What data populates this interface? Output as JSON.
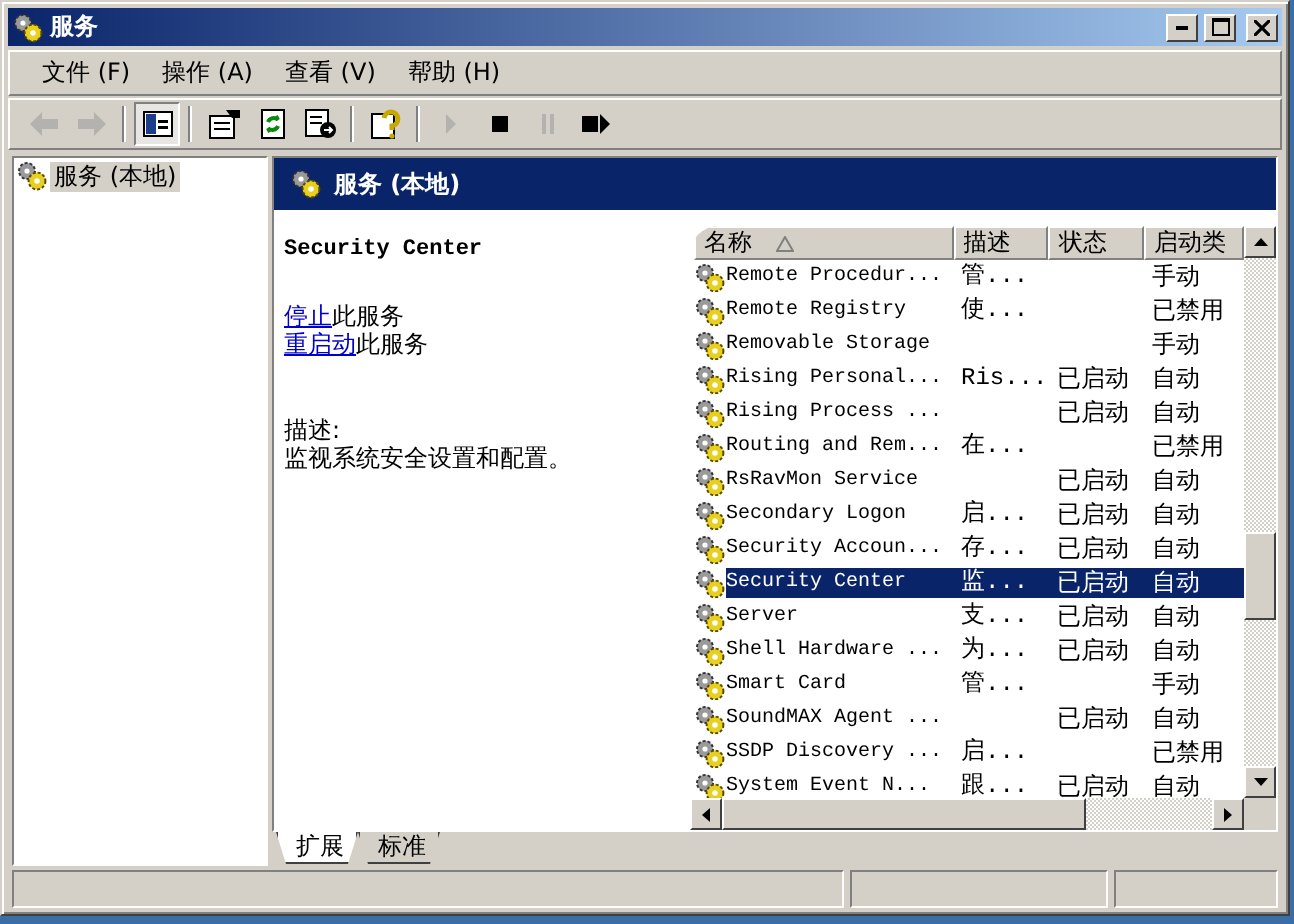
{
  "window": {
    "title": "服务"
  },
  "menu": [
    {
      "label": "文件 (F)"
    },
    {
      "label": "操作 (A)"
    },
    {
      "label": "查看 (V)"
    },
    {
      "label": "帮助 (H)"
    }
  ],
  "toolbar": [
    {
      "buttons": [
        {
          "kind": "back",
          "disabled": true,
          "pressed": false
        },
        {
          "kind": "forward",
          "disabled": true,
          "pressed": false
        }
      ]
    },
    {
      "buttons": [
        {
          "kind": "tree",
          "disabled": false,
          "pressed": true
        }
      ]
    },
    {
      "buttons": [
        {
          "kind": "properties",
          "disabled": false,
          "pressed": false
        },
        {
          "kind": "refresh",
          "disabled": false,
          "pressed": false
        },
        {
          "kind": "export",
          "disabled": false,
          "pressed": false
        }
      ]
    },
    {
      "buttons": [
        {
          "kind": "help",
          "disabled": false,
          "pressed": false
        }
      ]
    },
    {
      "buttons": [
        {
          "kind": "start",
          "disabled": true,
          "pressed": false
        },
        {
          "kind": "stop",
          "disabled": false,
          "pressed": false
        },
        {
          "kind": "pause",
          "disabled": true,
          "pressed": false
        },
        {
          "kind": "restart",
          "disabled": false,
          "pressed": false
        }
      ]
    }
  ],
  "tree": [
    {
      "label": "服务 (本地)",
      "selected": true
    }
  ],
  "header": {
    "title": "服务 (本地)"
  },
  "details": {
    "service_name": "Security Center",
    "actions": [
      {
        "link": "停止",
        "text": "此服务"
      },
      {
        "link": "重启动",
        "text": "此服务"
      }
    ],
    "description_label": "描述:",
    "description": "监视系统安全设置和配置。"
  },
  "table": {
    "columns": [
      {
        "label": "名称",
        "sorted": true
      },
      {
        "label": "描述",
        "sorted": false
      },
      {
        "label": "状态",
        "sorted": false
      },
      {
        "label": "启动类",
        "sorted": false
      }
    ],
    "rows": [
      {
        "name": "Remote Procedur...",
        "description": "管...",
        "status": "",
        "startup": "手动",
        "selected": false
      },
      {
        "name": "Remote Registry",
        "description": "使...",
        "status": "",
        "startup": "已禁用",
        "selected": false
      },
      {
        "name": "Removable Storage",
        "description": "",
        "status": "",
        "startup": "手动",
        "selected": false
      },
      {
        "name": "Rising Personal...",
        "description": "Ris...",
        "status": "已启动",
        "startup": "自动",
        "selected": false
      },
      {
        "name": "Rising Process ...",
        "description": "",
        "status": "已启动",
        "startup": "自动",
        "selected": false
      },
      {
        "name": "Routing and Rem...",
        "description": "在...",
        "status": "",
        "startup": "已禁用",
        "selected": false
      },
      {
        "name": "RsRavMon Service",
        "description": "",
        "status": "已启动",
        "startup": "自动",
        "selected": false
      },
      {
        "name": "Secondary Logon",
        "description": "启...",
        "status": "已启动",
        "startup": "自动",
        "selected": false
      },
      {
        "name": "Security Accoun...",
        "description": "存...",
        "status": "已启动",
        "startup": "自动",
        "selected": false
      },
      {
        "name": "Security Center",
        "description": "监...",
        "status": "已启动",
        "startup": "自动",
        "selected": true
      },
      {
        "name": "Server",
        "description": "支...",
        "status": "已启动",
        "startup": "自动",
        "selected": false
      },
      {
        "name": "Shell Hardware ...",
        "description": "为...",
        "status": "已启动",
        "startup": "自动",
        "selected": false
      },
      {
        "name": "Smart Card",
        "description": "管...",
        "status": "",
        "startup": "手动",
        "selected": false
      },
      {
        "name": "SoundMAX Agent ...",
        "description": "",
        "status": "已启动",
        "startup": "自动",
        "selected": false
      },
      {
        "name": "SSDP Discovery ...",
        "description": "启...",
        "status": "",
        "startup": "已禁用",
        "selected": false
      },
      {
        "name": "System Event N...",
        "description": "跟...",
        "status": "已启动",
        "startup": "自动",
        "selected": false
      }
    ]
  },
  "view_tabs": [
    {
      "label": "扩展",
      "selected": true
    },
    {
      "label": "标准",
      "selected": false
    }
  ]
}
